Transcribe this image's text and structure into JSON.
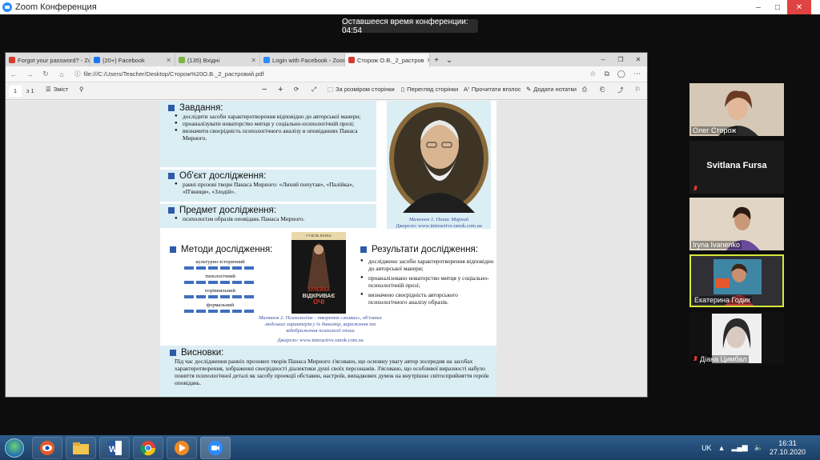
{
  "zoom": {
    "window_title": "Zoom Конференция",
    "timer": "Оставшееся время конференции: 04:54",
    "min": "–",
    "max": "□",
    "close": "✕"
  },
  "browser": {
    "tabs": [
      {
        "label": "Forgot your password? - Zo",
        "color": "#d43b2a"
      },
      {
        "label": "(20+) Facebook",
        "color": "#1877f2"
      },
      {
        "label": "(135) Вхідні",
        "color": "#7cb342"
      },
      {
        "label": "Login with Facebook - Zoor",
        "color": "#2d8cff"
      },
      {
        "label": "Сторож О.В._2_растров",
        "color": "#d43b2a"
      }
    ],
    "url": "file:///C:/Users/Teacher/Desktop/Сторож%20О.В._2_растровий.pdf",
    "toolbar": {
      "page_current": "1",
      "page_total": "з 1",
      "contents": "Зміст",
      "fit_page": "За розміром сторінки",
      "page_view": "Перегляд сторінки",
      "read_aloud": "Прочитати вголос",
      "add_notes": "Додати нотатки"
    }
  },
  "pdf": {
    "zavdannia_title": "Завдання:",
    "zavdannia_items": [
      "дослідити засоби характеротворення відповідно до авторської манери;",
      "проаналізувати новаторство митця у соціально-психологічній прозі;",
      "визначити своєрідність психологічного аналізу в оповіданнях Панаса Мирного."
    ],
    "object_title": "Об'єкт дослідження:",
    "object_items": [
      "ранні прозові твори Панаса Мирного: «Лихий попутав», «Палійка», «П'яниця», «Злодій»."
    ],
    "subject_title": "Предмет дослідження:",
    "subject_items": [
      "психологізм образів оповідань Панаса Мирного."
    ],
    "portrait_caption_1": "Малюнок 1. Панас Мирний",
    "portrait_caption_2": "Джерело: www.interactive.ranok.com.ua",
    "methods_title": "Методи дослідження:",
    "methods": [
      "культурно-історичний",
      "типологічний",
      "порівняльний",
      "формальний"
    ],
    "book_author": "ГУЗЕЛЬ ЯХІНА",
    "book_title_1": "ЗУЛЕЙХА",
    "book_title_2": "ВІДКРИВАЄ",
    "book_title_3": "ОЧІ",
    "results_title": "Результати дослідження:",
    "results": [
      "досліджено засоби характеротворення відповідно до авторської манери;",
      "проаналізовано новаторство митця у соціально-психологічній прозі;",
      "визначено своєрідність авторського психологічного аналізу образів."
    ],
    "fig2_caption": "Малюнок 2. Психологізм – творення «живих», об'ємних людських характерів у їх динаміці, вираження та відображення психології епохи",
    "fig2_source": "Джерело: www.interactive.ranok.com.ua",
    "conclusions_title": "Висновки:",
    "conclusions_text": "Під час дослідження ранніх прозових творів Панаса Мирного з'ясовано, що основну увагу автор зосередив на засобах характеротворення, зображенні своєрідності діалектики душі своїх персонажів. З'ясовано, що особливої виразності набуло поняття психологічної деталі як засобу проекції обставин, настроїв, випадкових думок на внутрішнє світосприйняття героїв оповідань."
  },
  "participants": [
    {
      "name": "Олег Сторож",
      "muted": false,
      "video": true,
      "bg": "#c9b9a6"
    },
    {
      "name": "Svitlana Fursa",
      "muted": true,
      "video": false,
      "bg": "#1a1a1a"
    },
    {
      "name": "Iryna Ivanenko",
      "muted": false,
      "video": true,
      "bg": "#d9cbb6"
    },
    {
      "name": "Екатерина Годик",
      "muted": false,
      "video": true,
      "bg": "#3b86a8",
      "active_speaker": true
    },
    {
      "name": "Діана Цимбал",
      "muted": true,
      "video": true,
      "bg": "#e5e3e0"
    }
  ],
  "taskbar": {
    "lang": "UK",
    "time": "16:31",
    "date": "27.10.2020"
  }
}
